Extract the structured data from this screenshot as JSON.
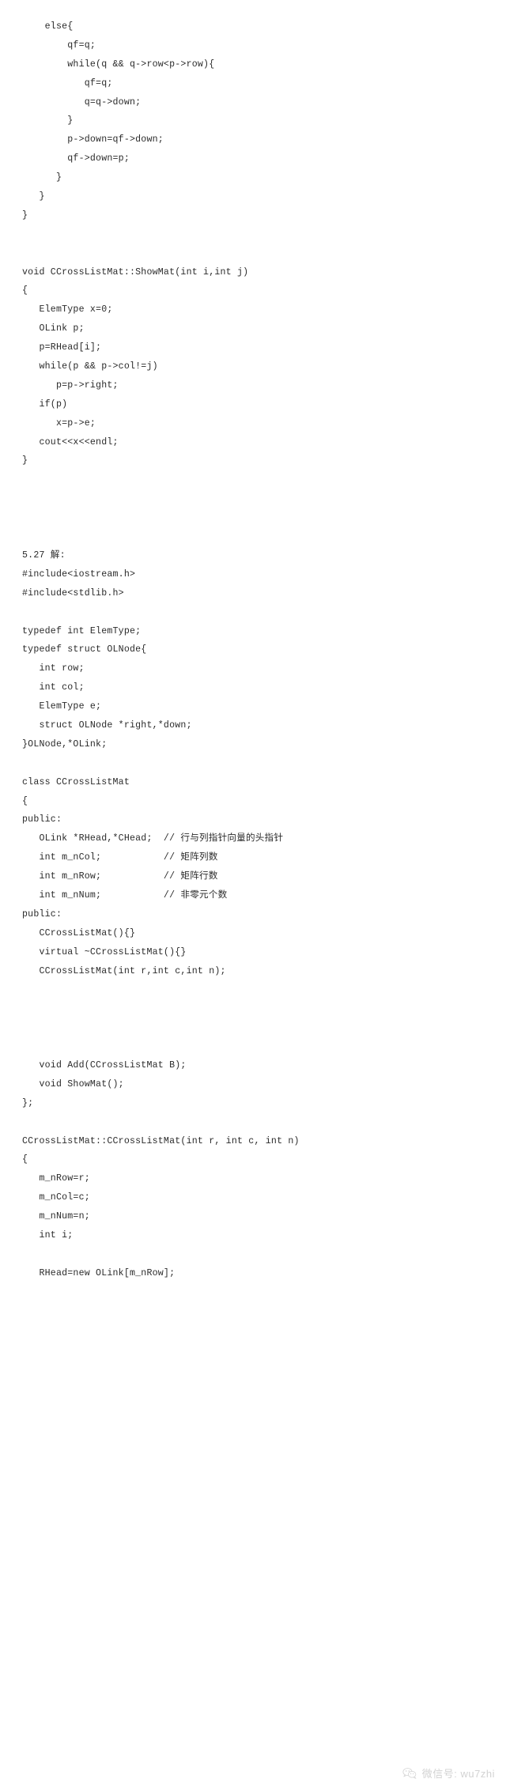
{
  "document": {
    "type": "code-listing",
    "language": "C++",
    "section_label": "5.27 解:",
    "lines": [
      "    else{",
      "        qf=q;",
      "        while(q && q->row<p->row){",
      "           qf=q;",
      "           q=q->down;",
      "        }",
      "        p->down=qf->down;",
      "        qf->down=p;",
      "      }",
      "   }",
      "}",
      "",
      "",
      "void CCrossListMat::ShowMat(int i,int j)",
      "{",
      "   ElemType x=0;",
      "   OLink p;",
      "   p=RHead[i];",
      "   while(p && p->col!=j)",
      "      p=p->right;",
      "   if(p)",
      "      x=p->e;",
      "   cout<<x<<endl;",
      "}",
      "",
      "",
      "",
      "",
      "5.27 解:",
      "#include<iostream.h>",
      "#include<stdlib.h>",
      "",
      "typedef int ElemType;",
      "typedef struct OLNode{",
      "   int row;",
      "   int col;",
      "   ElemType e;",
      "   struct OLNode *right,*down;",
      "}OLNode,*OLink;",
      "",
      "class CCrossListMat",
      "{",
      "public:",
      "   OLink *RHead,*CHead;  // 行与列指针向量的头指针",
      "   int m_nCol;           // 矩阵列数",
      "   int m_nRow;           // 矩阵行数",
      "   int m_nNum;           // 非零元个数",
      "public:",
      "   CCrossListMat(){}",
      "   virtual ~CCrossListMat(){}",
      "   CCrossListMat(int r,int c,int n);",
      "",
      "",
      "",
      "",
      "   void Add(CCrossListMat B);",
      "   void ShowMat();",
      "};",
      "",
      "CCrossListMat::CCrossListMat(int r, int c, int n)",
      "{",
      "   m_nRow=r;",
      "   m_nCol=c;",
      "   m_nNum=n;",
      "   int i;",
      "",
      "   RHead=new OLink[m_nRow];"
    ]
  },
  "watermark": {
    "icon": "wechat-icon",
    "text": "微信号: wu7zhi",
    "color": "#d2d2d2"
  }
}
